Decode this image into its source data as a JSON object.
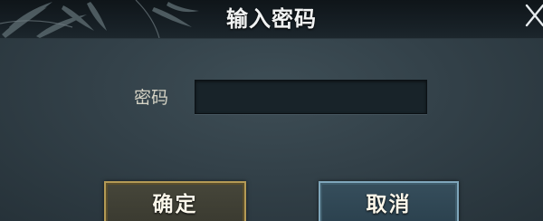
{
  "dialog": {
    "title": "输入密码",
    "password_label": "密码",
    "password_value": "",
    "password_placeholder": "",
    "ok_label": "确定",
    "cancel_label": "取消"
  },
  "icons": {
    "close": "close-icon",
    "decoration": "bamboo-leaves-icon"
  },
  "colors": {
    "ok_border": "#b49a55",
    "cancel_border": "#7fa6bb",
    "panel": "#334149"
  }
}
